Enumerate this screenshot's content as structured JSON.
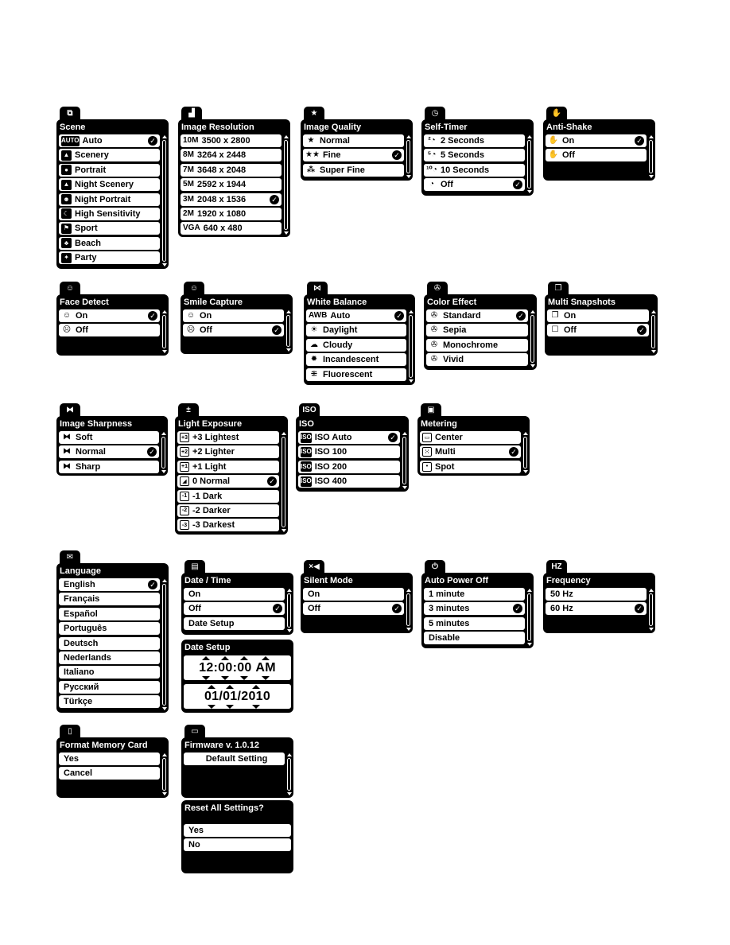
{
  "panels": {
    "scene": {
      "tab_icon": "scene-icon",
      "title": "Scene",
      "items": [
        {
          "icon": "auto-icon",
          "glyph": "AUTO",
          "label": "Auto",
          "selected": true
        },
        {
          "icon": "scenery-icon",
          "glyph": "▲",
          "label": "Scenery"
        },
        {
          "icon": "portrait-icon",
          "glyph": "●",
          "label": "Portrait"
        },
        {
          "icon": "night-scenery-icon",
          "glyph": "▲",
          "label": "Night Scenery"
        },
        {
          "icon": "night-portrait-icon",
          "glyph": "☻",
          "label": "Night Portrait"
        },
        {
          "icon": "high-sensitivity-icon",
          "glyph": "☾",
          "label": "High Sensitivity"
        },
        {
          "icon": "sport-icon",
          "glyph": "⚑",
          "label": "Sport"
        },
        {
          "icon": "beach-icon",
          "glyph": "♣",
          "label": "Beach"
        },
        {
          "icon": "party-icon",
          "glyph": "✦",
          "label": "Party"
        }
      ]
    },
    "image_resolution": {
      "tab_icon": "resolution-icon",
      "title": "Image Resolution",
      "items": [
        {
          "icon": "10m-icon",
          "glyph": "10M",
          "label": "3500 x 2800"
        },
        {
          "icon": "8m-icon",
          "glyph": "8M",
          "label": "3264 x 2448"
        },
        {
          "icon": "7m-hd-icon",
          "glyph": "7M",
          "label": "3648 x 2048"
        },
        {
          "icon": "5m-icon",
          "glyph": "5M",
          "label": "2592 x 1944"
        },
        {
          "icon": "3m-icon",
          "glyph": "3M",
          "label": "2048 x 1536",
          "selected": true
        },
        {
          "icon": "2m-hd-icon",
          "glyph": "2M",
          "label": "1920 x 1080"
        },
        {
          "icon": "vga-icon",
          "glyph": "VGA",
          "label": "640 x 480"
        }
      ]
    },
    "image_quality": {
      "tab_icon": "star-icon",
      "title": "Image Quality",
      "items": [
        {
          "icon": "one-star-icon",
          "glyph": "★",
          "label": "Normal"
        },
        {
          "icon": "two-star-icon",
          "glyph": "★★",
          "label": "Fine",
          "selected": true
        },
        {
          "icon": "three-star-icon",
          "glyph": "⁂",
          "label": "Super Fine"
        }
      ]
    },
    "self_timer": {
      "tab_icon": "timer-icon",
      "title": "Self-Timer",
      "items": [
        {
          "icon": "timer-2-icon",
          "glyph": "²◔",
          "label": "2 Seconds"
        },
        {
          "icon": "timer-5-icon",
          "glyph": "⁵◔",
          "label": "5 Seconds"
        },
        {
          "icon": "timer-10-icon",
          "glyph": "¹⁰◔",
          "label": "10 Seconds"
        },
        {
          "icon": "timer-off-icon",
          "glyph": "◔",
          "label": "Off",
          "selected": true
        }
      ]
    },
    "anti_shake": {
      "tab_icon": "hand-icon",
      "title": "Anti-Shake",
      "items": [
        {
          "icon": "hand-shake-on-icon",
          "glyph": "✋",
          "label": "On",
          "selected": true
        },
        {
          "icon": "hand-shake-off-icon",
          "glyph": "✋",
          "label": "Off"
        }
      ]
    },
    "face_detect": {
      "tab_icon": "face-icon",
      "title": "Face Detect",
      "items": [
        {
          "icon": "face-on-icon",
          "glyph": "☺",
          "label": "On",
          "selected": true
        },
        {
          "icon": "face-off-icon",
          "glyph": "☹",
          "label": "Off"
        }
      ]
    },
    "smile_capture": {
      "tab_icon": "smile-icon",
      "title": "Smile Capture",
      "items": [
        {
          "icon": "smile-on-icon",
          "glyph": "☺",
          "label": "On"
        },
        {
          "icon": "smile-off-icon",
          "glyph": "☹",
          "label": "Off",
          "selected": true
        }
      ]
    },
    "white_balance": {
      "tab_icon": "white-balance-icon",
      "title": "White Balance",
      "items": [
        {
          "icon": "awb-icon",
          "glyph": "AWB",
          "label": "Auto",
          "selected": true
        },
        {
          "icon": "sun-icon",
          "glyph": "☀",
          "label": "Daylight"
        },
        {
          "icon": "cloud-icon",
          "glyph": "☁",
          "label": "Cloudy"
        },
        {
          "icon": "bulb-icon",
          "glyph": "✹",
          "label": "Incandescent"
        },
        {
          "icon": "fluorescent-icon",
          "glyph": "⁜",
          "label": "Fluorescent"
        }
      ]
    },
    "color_effect": {
      "tab_icon": "color-effect-icon",
      "title": "Color Effect",
      "items": [
        {
          "icon": "standard-color-icon",
          "glyph": "✇",
          "label": "Standard",
          "selected": true
        },
        {
          "icon": "sepia-icon",
          "glyph": "✇",
          "label": "Sepia"
        },
        {
          "icon": "monochrome-icon",
          "glyph": "✇",
          "label": "Monochrome"
        },
        {
          "icon": "vivid-icon",
          "glyph": "✇",
          "label": "Vivid"
        }
      ]
    },
    "multi_snapshots": {
      "tab_icon": "multi-snapshot-icon",
      "title": "Multi Snapshots",
      "items": [
        {
          "icon": "multi-on-icon",
          "glyph": "❐",
          "label": "On"
        },
        {
          "icon": "multi-off-icon",
          "glyph": "☐",
          "label": "Off",
          "selected": true
        }
      ]
    },
    "image_sharpness": {
      "tab_icon": "sharpness-icon",
      "title": "Image Sharpness",
      "items": [
        {
          "icon": "soft-icon",
          "glyph": "⧓",
          "label": "Soft"
        },
        {
          "icon": "normal-sharpness-icon",
          "glyph": "⧓",
          "label": "Normal",
          "selected": true
        },
        {
          "icon": "sharp-icon",
          "glyph": "⧓",
          "label": "Sharp"
        }
      ]
    },
    "light_exposure": {
      "tab_icon": "exposure-icon",
      "title": "Light Exposure",
      "items": [
        {
          "icon": "exposure-plus3-icon",
          "glyph": "+3",
          "label": "+3 Lightest"
        },
        {
          "icon": "exposure-plus2-icon",
          "glyph": "+2",
          "label": "+2 Lighter"
        },
        {
          "icon": "exposure-plus1-icon",
          "glyph": "+1",
          "label": "+1 Light"
        },
        {
          "icon": "exposure-zero-icon",
          "glyph": "◢",
          "label": "0 Normal",
          "selected": true
        },
        {
          "icon": "exposure-minus1-icon",
          "glyph": "-1",
          "label": "-1 Dark"
        },
        {
          "icon": "exposure-minus2-icon",
          "glyph": "-2",
          "label": "-2 Darker"
        },
        {
          "icon": "exposure-minus3-icon",
          "glyph": "-3",
          "label": "-3 Darkest"
        }
      ]
    },
    "iso": {
      "tab_icon": "iso-icon",
      "title": "ISO",
      "items": [
        {
          "icon": "iso-auto-icon",
          "glyph": "ISO",
          "label": "ISO Auto",
          "selected": true
        },
        {
          "icon": "iso-100-icon",
          "glyph": "ISO",
          "label": "ISO 100"
        },
        {
          "icon": "iso-200-icon",
          "glyph": "ISO",
          "label": "ISO 200"
        },
        {
          "icon": "iso-400-icon",
          "glyph": "ISO",
          "label": "ISO 400"
        }
      ]
    },
    "metering": {
      "tab_icon": "metering-icon",
      "title": "Metering",
      "items": [
        {
          "icon": "center-metering-icon",
          "glyph": "▭",
          "label": "Center"
        },
        {
          "icon": "multi-metering-icon",
          "glyph": "⁙",
          "label": "Multi",
          "selected": true
        },
        {
          "icon": "spot-metering-icon",
          "glyph": "•",
          "label": "Spot"
        }
      ]
    },
    "language": {
      "tab_icon": "speech-bubble-icon",
      "title": "Language",
      "items": [
        {
          "label": "English",
          "selected": true
        },
        {
          "label": "Français"
        },
        {
          "label": "Español"
        },
        {
          "label": "Português"
        },
        {
          "label": "Deutsch"
        },
        {
          "label": "Nederlands"
        },
        {
          "label": "Italiano"
        },
        {
          "label": "Русский"
        },
        {
          "label": "Türkçe"
        }
      ]
    },
    "date_time": {
      "tab_icon": "calendar-icon",
      "title": "Date / Time",
      "items": [
        {
          "label": "On"
        },
        {
          "label": "Off",
          "selected": true
        },
        {
          "label": "Date Setup"
        }
      ]
    },
    "date_setup": {
      "title": "Date Setup",
      "time": {
        "hour": "12",
        "minute": "00",
        "second": "00",
        "ampm": "AM"
      },
      "date": {
        "month": "01",
        "day": "01",
        "year": "2010"
      }
    },
    "silent_mode": {
      "tab_icon": "mute-speaker-icon",
      "title": "Silent Mode",
      "items": [
        {
          "label": "On"
        },
        {
          "label": "Off",
          "selected": true
        }
      ]
    },
    "auto_power_off": {
      "tab_icon": "power-icon",
      "title": "Auto Power Off",
      "items": [
        {
          "label": "1 minute"
        },
        {
          "label": "3 minutes",
          "selected": true
        },
        {
          "label": "5 minutes"
        },
        {
          "label": "Disable"
        }
      ]
    },
    "frequency": {
      "tab_icon": "hz-icon",
      "tab_glyph": "HZ",
      "title": "Frequency",
      "items": [
        {
          "label": "50 Hz"
        },
        {
          "label": "60 Hz",
          "selected": true
        }
      ]
    },
    "format_memory_card": {
      "tab_icon": "sd-card-icon",
      "title": "Format Memory Card",
      "items": [
        {
          "label": "Yes"
        },
        {
          "label": "Cancel"
        }
      ]
    },
    "firmware": {
      "tab_icon": "window-icon",
      "title": "Firmware v. 1.0.12",
      "items": [
        {
          "label": "Default Setting"
        }
      ]
    },
    "reset_all": {
      "title": "Reset All Settings?",
      "items": [
        {
          "label": "Yes"
        },
        {
          "label": "No"
        }
      ]
    }
  },
  "tab_glyphs": {
    "scene": "⧉",
    "image_resolution": "▟",
    "image_quality": "★",
    "self_timer": "◷",
    "anti_shake": "✋",
    "face_detect": "☺",
    "smile_capture": "☺",
    "white_balance": "⋈",
    "color_effect": "✇",
    "multi_snapshots": "❐",
    "image_sharpness": "⧓",
    "light_exposure": "±",
    "iso": "ISO",
    "metering": "▣",
    "language": "✉",
    "date_time": "▤",
    "silent_mode": "×◀",
    "auto_power_off": "⏻",
    "frequency": "HZ",
    "format_memory_card": "▯",
    "firmware": "▭"
  },
  "check_glyph": "✓"
}
